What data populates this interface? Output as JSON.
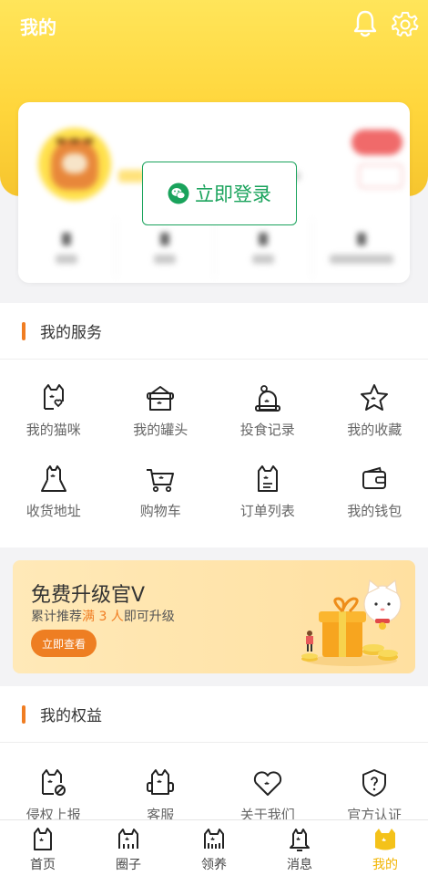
{
  "header": {
    "title": "我的"
  },
  "login": {
    "label": "立即登录"
  },
  "services": {
    "title": "我的服务",
    "items": [
      {
        "label": "我的猫咪",
        "icon": "cat-heart-icon"
      },
      {
        "label": "我的罐头",
        "icon": "cat-can-icon"
      },
      {
        "label": "投食记录",
        "icon": "feeding-record-icon"
      },
      {
        "label": "我的收藏",
        "icon": "star-cat-icon"
      },
      {
        "label": "收货地址",
        "icon": "address-icon"
      },
      {
        "label": "购物车",
        "icon": "cart-icon"
      },
      {
        "label": "订单列表",
        "icon": "order-list-icon"
      },
      {
        "label": "我的钱包",
        "icon": "wallet-icon"
      }
    ]
  },
  "banner": {
    "title": "免费升级官V",
    "sub_prefix": "累计推荐",
    "sub_highlight": "满 3 人",
    "sub_suffix": "即可升级",
    "button": "立即查看"
  },
  "rights": {
    "title": "我的权益",
    "items": [
      {
        "label": "侵权上报",
        "icon": "report-icon"
      },
      {
        "label": "客服",
        "icon": "service-icon"
      },
      {
        "label": "关于我们",
        "icon": "about-icon"
      },
      {
        "label": "官方认证",
        "icon": "certify-icon"
      }
    ]
  },
  "tabbar": {
    "items": [
      {
        "label": "首页",
        "icon": "home-cat-icon"
      },
      {
        "label": "圈子",
        "icon": "circle-cat-icon"
      },
      {
        "label": "领养",
        "icon": "adopt-cat-icon"
      },
      {
        "label": "消息",
        "icon": "message-bell-icon"
      },
      {
        "label": "我的",
        "icon": "mine-cat-icon",
        "active": true
      }
    ]
  },
  "colors": {
    "brand": "#ffd63c",
    "accent": "#f07d22",
    "wechat": "#1aa35c",
    "active_tab": "#f2b400"
  }
}
